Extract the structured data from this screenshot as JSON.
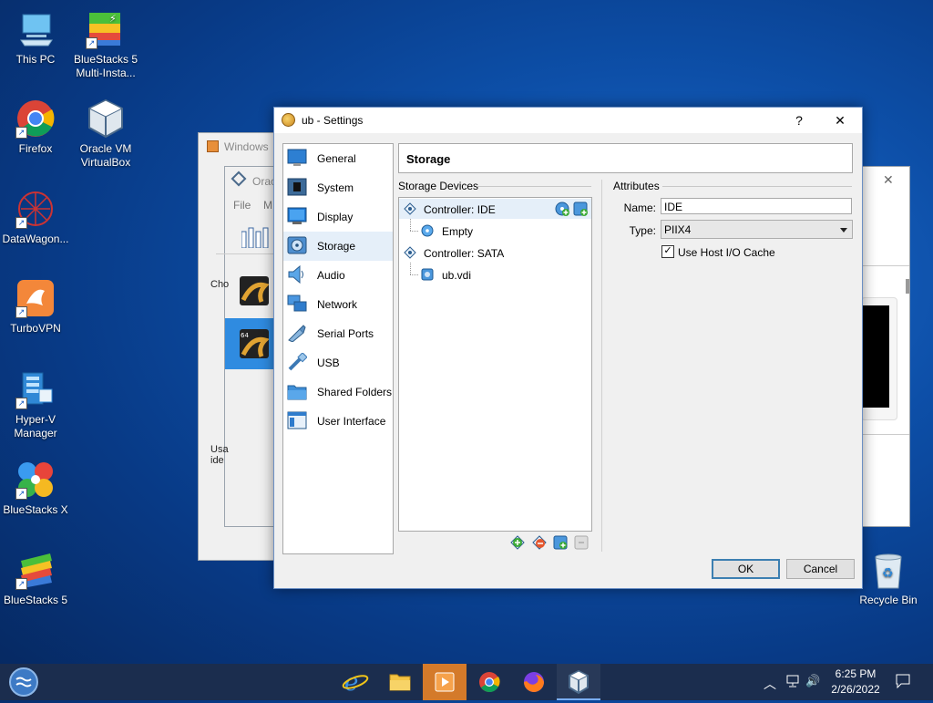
{
  "desktop": {
    "icons": [
      {
        "label": "This PC"
      },
      {
        "label": "BlueStacks 5\nMulti-Insta..."
      },
      {
        "label": "Firefox"
      },
      {
        "label": "Oracle VM\nVirtualBox"
      },
      {
        "label": "DataWagon..."
      },
      {
        "label": "TurboVPN"
      },
      {
        "label": "Hyper-V\nManager"
      },
      {
        "label": "BlueStacks X"
      },
      {
        "label": "BlueStacks 5"
      },
      {
        "label": "Recycle Bin"
      }
    ]
  },
  "background_windows": {
    "win1_title": "Windows",
    "win2_title": "Orac",
    "win2_menu": [
      "File",
      "M"
    ],
    "side_text1": "Cho",
    "side_text2": "Usa",
    "side_text3": "ide"
  },
  "dialog": {
    "title": "ub - Settings",
    "help": "?",
    "close": "✕",
    "nav": [
      {
        "label": "General"
      },
      {
        "label": "System"
      },
      {
        "label": "Display"
      },
      {
        "label": "Storage"
      },
      {
        "label": "Audio"
      },
      {
        "label": "Network"
      },
      {
        "label": "Serial Ports"
      },
      {
        "label": "USB"
      },
      {
        "label": "Shared Folders"
      },
      {
        "label": "User Interface"
      }
    ],
    "section_title": "Storage",
    "storage_devices_label": "Storage Devices",
    "attributes_label": "Attributes",
    "tree": [
      {
        "label": "Controller: IDE"
      },
      {
        "label": "Empty"
      },
      {
        "label": "Controller: SATA"
      },
      {
        "label": "ub.vdi"
      }
    ],
    "name_label": "Name:",
    "name_value": "IDE",
    "type_label": "Type:",
    "type_value": "PIIX4",
    "host_io_cache_label": "Use Host I/O Cache",
    "host_io_cache_checked": true,
    "ok": "OK",
    "cancel": "Cancel"
  },
  "taskbar": {
    "time": "6:25 PM",
    "date": "2/26/2022"
  }
}
